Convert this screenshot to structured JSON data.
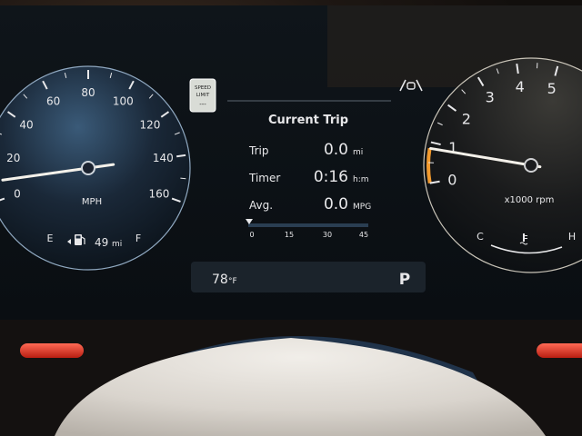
{
  "speedometer": {
    "unit": "MPH",
    "ticks": [
      "0",
      "20",
      "40",
      "60",
      "80",
      "100",
      "120",
      "140",
      "160"
    ],
    "speed_value": 0,
    "fuel_empty_label": "E",
    "fuel_full_label": "F",
    "range": "49",
    "range_unit": "mi"
  },
  "speed_limit_sign": {
    "line1": "SPEED",
    "line2": "LIMIT",
    "line3": "---"
  },
  "trip": {
    "title": "Current Trip",
    "rows": [
      {
        "label": "Trip",
        "value": "0.0",
        "unit": "mi"
      },
      {
        "label": "Timer",
        "value": "0:16",
        "unit": "h:m"
      },
      {
        "label": "Avg.",
        "value": "0.0",
        "unit": "MPG"
      }
    ],
    "scale_ticks": [
      "0",
      "15",
      "30",
      "45"
    ],
    "scale_value": 0
  },
  "status_bar": {
    "temperature": "78",
    "temperature_unit": "°F",
    "gear": "P"
  },
  "tachometer": {
    "unit": "x1000 rpm",
    "ticks": [
      "0",
      "1",
      "2",
      "3",
      "4",
      "5"
    ],
    "rpm_value": 0.85,
    "temp_cold_label": "C",
    "temp_hot_label": "H"
  },
  "colors": {
    "accent_orange": "#f29a2e",
    "needle": "#f4f1ea",
    "display_bg": "#0c1115"
  }
}
